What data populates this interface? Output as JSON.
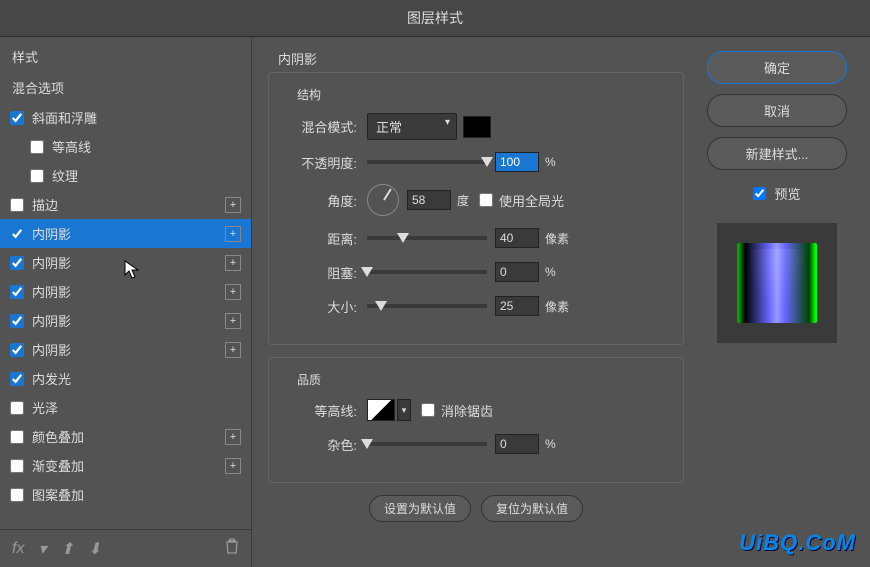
{
  "dialog": {
    "title": "图层样式"
  },
  "sidebar": {
    "header": "样式",
    "blending": "混合选项",
    "items": [
      {
        "label": "斜面和浮雕",
        "checked": true,
        "indent": false,
        "add": false
      },
      {
        "label": "等高线",
        "checked": false,
        "indent": true,
        "add": false
      },
      {
        "label": "纹理",
        "checked": false,
        "indent": true,
        "add": false
      },
      {
        "label": "描边",
        "checked": false,
        "indent": false,
        "add": true
      },
      {
        "label": "内阴影",
        "checked": true,
        "indent": false,
        "add": true,
        "selected": true
      },
      {
        "label": "内阴影",
        "checked": true,
        "indent": false,
        "add": true
      },
      {
        "label": "内阴影",
        "checked": true,
        "indent": false,
        "add": true
      },
      {
        "label": "内阴影",
        "checked": true,
        "indent": false,
        "add": true
      },
      {
        "label": "内阴影",
        "checked": true,
        "indent": false,
        "add": true
      },
      {
        "label": "内发光",
        "checked": true,
        "indent": false,
        "add": false
      },
      {
        "label": "光泽",
        "checked": false,
        "indent": false,
        "add": false
      },
      {
        "label": "颜色叠加",
        "checked": false,
        "indent": false,
        "add": true
      },
      {
        "label": "渐变叠加",
        "checked": false,
        "indent": false,
        "add": true
      },
      {
        "label": "图案叠加",
        "checked": false,
        "indent": false,
        "add": false
      }
    ],
    "fx": "fx"
  },
  "panel": {
    "title": "内阴影",
    "structure": {
      "legend": "结构",
      "blend_label": "混合模式:",
      "blend_value": "正常",
      "opacity_label": "不透明度:",
      "opacity_value": "100",
      "opacity_unit": "%",
      "angle_label": "角度:",
      "angle_value": "58",
      "angle_unit": "度",
      "global_light": "使用全局光",
      "distance_label": "距离:",
      "distance_value": "40",
      "distance_unit": "像素",
      "choke_label": "阻塞:",
      "choke_value": "0",
      "choke_unit": "%",
      "size_label": "大小:",
      "size_value": "25",
      "size_unit": "像素"
    },
    "quality": {
      "legend": "品质",
      "contour_label": "等高线:",
      "antialias": "消除锯齿",
      "noise_label": "杂色:",
      "noise_value": "0",
      "noise_unit": "%"
    },
    "make_default": "设置为默认值",
    "reset_default": "复位为默认值"
  },
  "right": {
    "ok": "确定",
    "cancel": "取消",
    "new_style": "新建样式...",
    "preview": "预览"
  },
  "watermark": "UiBQ.CoM"
}
